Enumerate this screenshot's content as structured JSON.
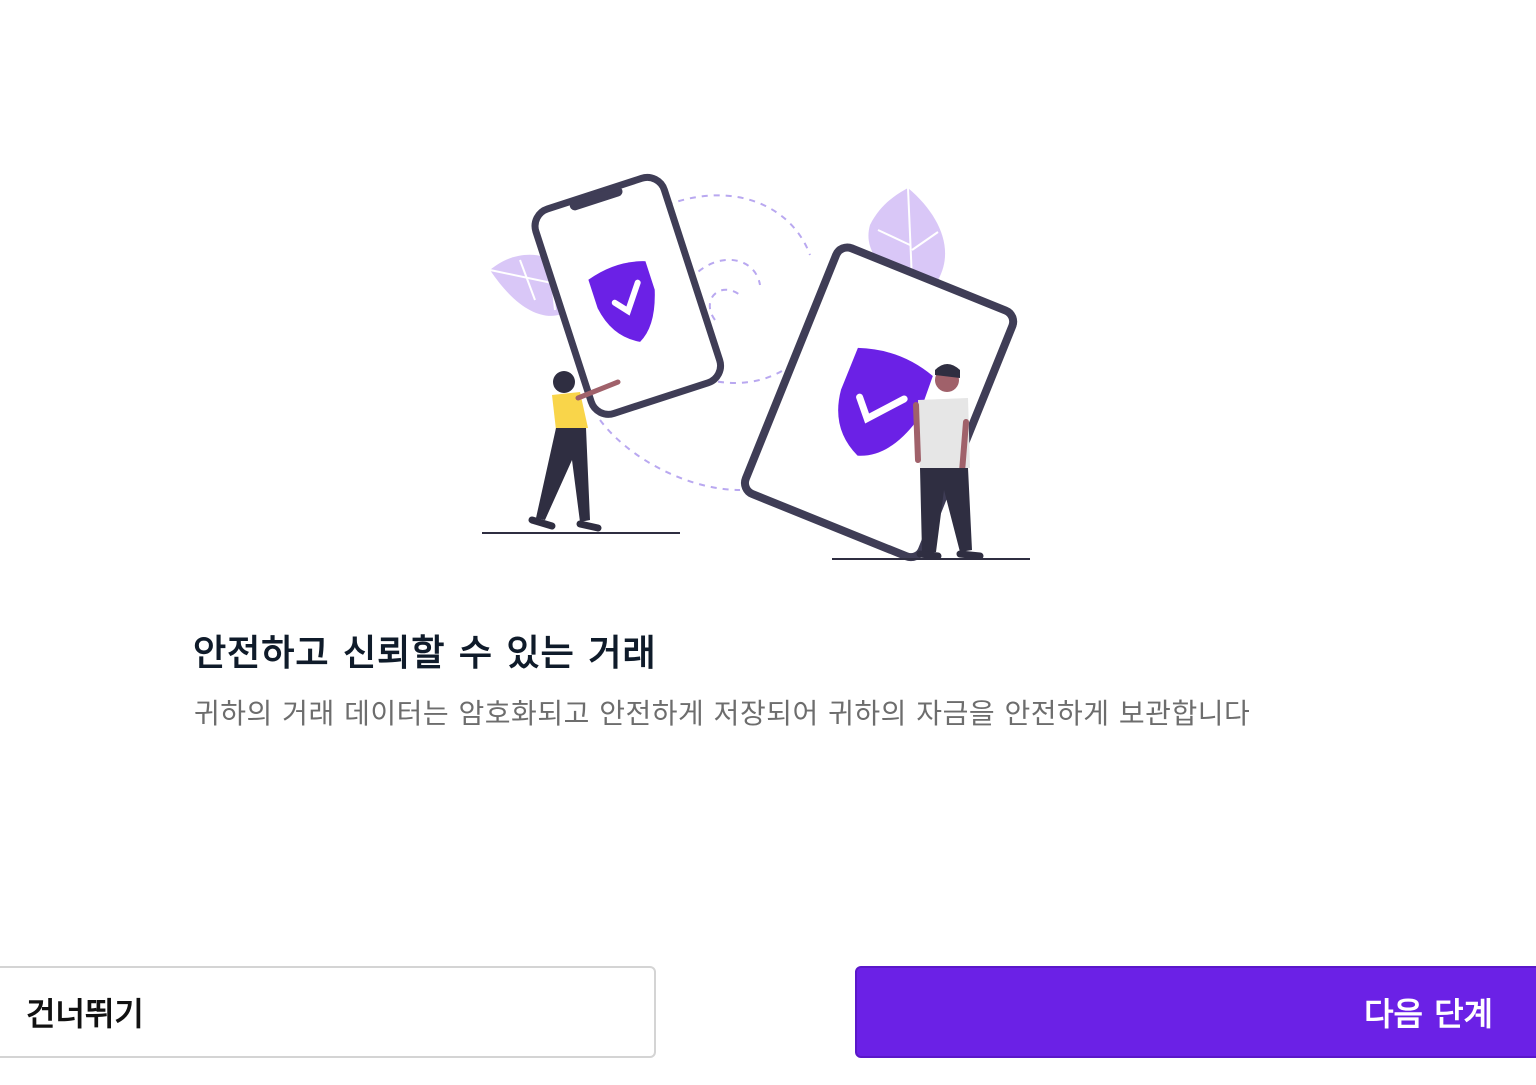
{
  "main": {
    "title": "안전하고 신뢰할 수 있는 거래",
    "description": "귀하의 거래 데이터는 암호화되고 안전하게 저장되어 귀하의 자금을 안전하게 보관합니다"
  },
  "actions": {
    "skip_label": "건너뛰기",
    "next_label": "다음 단계"
  },
  "illustration": {
    "icon": "shield-check-icon",
    "colors": {
      "accent": "#6b21e6",
      "leaf": "#d9c7f7",
      "device_frame": "#3f3d56",
      "dashed_arc": "#b9a8f0"
    }
  },
  "theme": {
    "primary": "#6b21e6",
    "heading": "#0f1b2a",
    "body_text": "#6d6d6d",
    "border": "#d4d4d4"
  }
}
